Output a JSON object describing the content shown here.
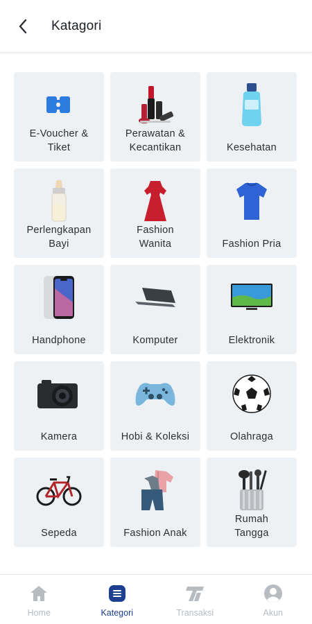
{
  "header": {
    "title": "Katagori"
  },
  "categories": [
    {
      "label": "E-Voucher &\nTiket",
      "icon": "ticket-icon"
    },
    {
      "label": "Perawatan &\nKecantikan",
      "icon": "cosmetics-icon"
    },
    {
      "label": "Kesehatan",
      "icon": "mouthwash-bottle-icon"
    },
    {
      "label": "Perlengkapan\nBayi",
      "icon": "baby-bottle-icon"
    },
    {
      "label": "Fashion\nWanita",
      "icon": "dress-icon"
    },
    {
      "label": "Fashion Pria",
      "icon": "shirt-icon"
    },
    {
      "label": "Handphone",
      "icon": "smartphone-icon"
    },
    {
      "label": "Komputer",
      "icon": "laptop-icon"
    },
    {
      "label": "Elektronik",
      "icon": "television-icon"
    },
    {
      "label": "Kamera",
      "icon": "camera-icon"
    },
    {
      "label": "Hobi & Koleksi",
      "icon": "gamepad-icon"
    },
    {
      "label": "Olahraga",
      "icon": "soccer-ball-icon"
    },
    {
      "label": "Sepeda",
      "icon": "bicycle-icon"
    },
    {
      "label": "Fashion Anak",
      "icon": "kids-clothes-icon"
    },
    {
      "label": "Rumah\nTangga",
      "icon": "kitchen-utensils-icon"
    }
  ],
  "bottom_nav": [
    {
      "label": "Home",
      "icon": "home-icon",
      "active": false
    },
    {
      "label": "Kategori",
      "icon": "category-list-icon",
      "active": true
    },
    {
      "label": "Transaksi",
      "icon": "transaction-icon",
      "active": false
    },
    {
      "label": "Akun",
      "icon": "account-icon",
      "active": false
    }
  ],
  "colors": {
    "tile_bg": "#eef1f3",
    "active_nav": "#1d3f8f",
    "inactive_nav": "#b7bcc1"
  }
}
